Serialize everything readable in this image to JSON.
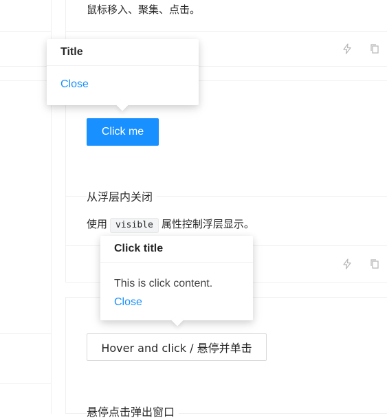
{
  "demo_top": {
    "description": "鼠标移入、聚集、点击。",
    "popover": {
      "title": "Title",
      "close_link": "Close"
    },
    "button_label": "Click me"
  },
  "demo_close": {
    "section_title": "从浮层内关闭",
    "desc_prefix": "使用",
    "code": "visible",
    "desc_suffix": "属性控制浮层显示。"
  },
  "demo_hover_click": {
    "popover": {
      "title": "Click title",
      "content": "This is click content.",
      "close_link": "Close"
    },
    "button_label": "Hover and click / 悬停并单击",
    "next_section_title": "悬停点击弹出窗口"
  },
  "icons": {
    "action_1": "thunderbolt-icon",
    "action_2": "copy-icon"
  },
  "colors": {
    "primary": "#1890ff",
    "border": "#f0f0f0",
    "icon": "#b5b5b5"
  }
}
